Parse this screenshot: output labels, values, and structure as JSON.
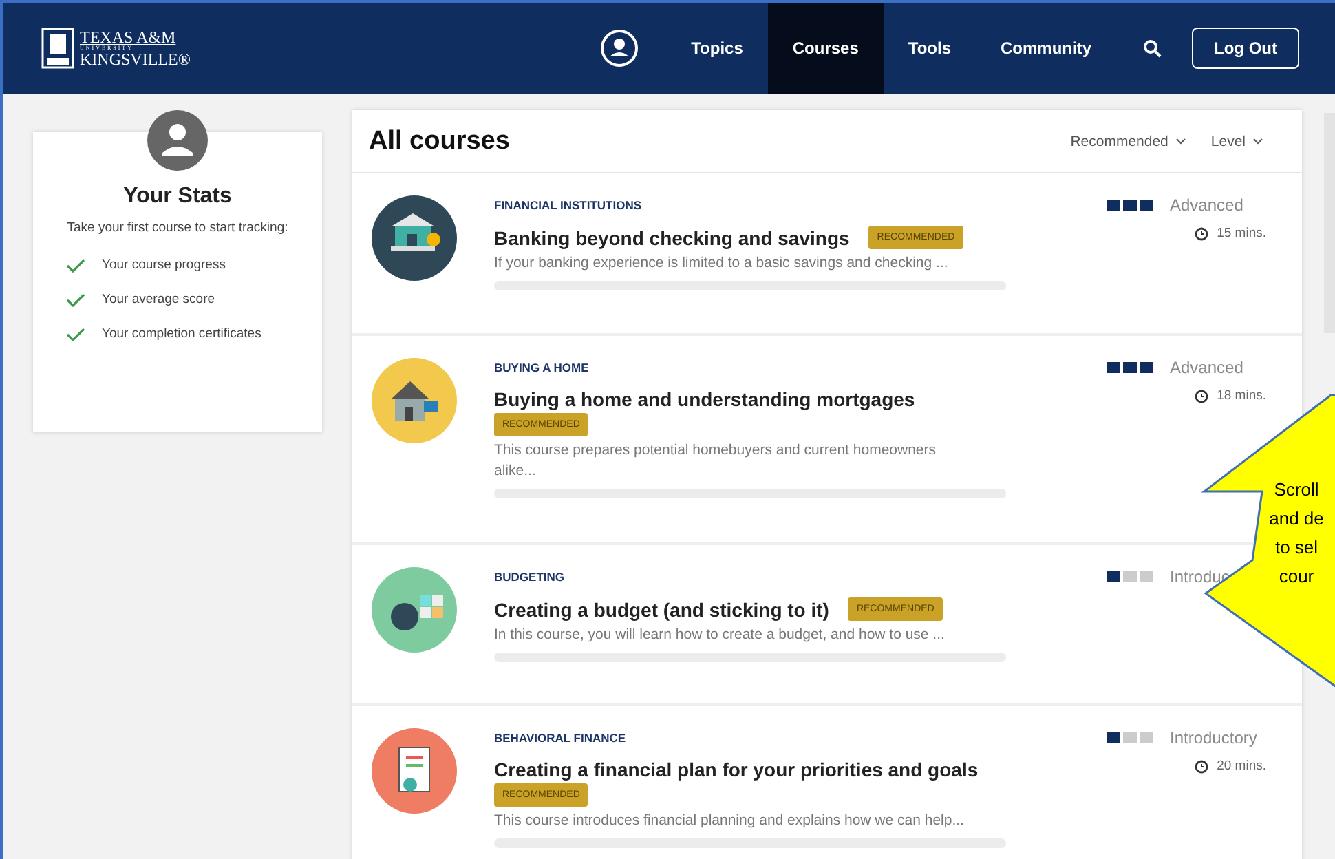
{
  "header": {
    "logo": {
      "line_1": "TEXAS A&M",
      "line_2": "UNIVERSITY",
      "line_3": "KINGSVILLE®"
    },
    "nav": [
      {
        "label": "Topics",
        "selected": false
      },
      {
        "label": "Courses",
        "selected": true
      },
      {
        "label": "Tools",
        "selected": false
      },
      {
        "label": "Community",
        "selected": false
      }
    ],
    "logout": "Log Out"
  },
  "stats": {
    "title": "Your Stats",
    "subtitle": "Take your first course to start tracking:",
    "items": [
      "Your course progress",
      "Your average score",
      "Your completion certificates"
    ]
  },
  "courses": {
    "title": "All courses",
    "filters": [
      "Recommended",
      "Level"
    ],
    "items": [
      {
        "category": "FINANCIAL INSTITUTIONS",
        "title": "Banking beyond checking and savings",
        "badge": "RECOMMENDED",
        "description": "If your banking experience is limited to a basic savings and checking ...",
        "level_name": "Advanced",
        "stars": 3,
        "time": "15 mins.",
        "color": "#2f4858",
        "progress": {
          "level": 0
        }
      },
      {
        "category": "BUYING A HOME",
        "title": "Buying a home and understanding mortgages",
        "badge": "RECOMMENDED",
        "description": "This course prepares potential homebuyers and current homeowners alike...",
        "level_name": "Advanced",
        "stars": 3,
        "time": "18 mins.",
        "color": "#f2c94c",
        "progress": {
          "level": 0
        }
      },
      {
        "category": "BUDGETING",
        "title": "Creating a budget (and sticking to it)",
        "badge": "RECOMMENDED",
        "description": "In this course, you will learn how to create a budget, and how to use ...",
        "level_name": "Introduc",
        "stars": 1,
        "color": "#7fcba0",
        "progress": {
          "level": 0
        }
      },
      {
        "category": "BEHAVIORAL FINANCE",
        "title": "Creating a financial plan for your priorities and goals",
        "badge": "RECOMMENDED",
        "description": "This course introduces financial planning and explains how we can help...",
        "level_name": "Introductory",
        "stars": 1,
        "time": "20 mins.",
        "color": "#ee7d63",
        "progress": {
          "level": 0
        }
      }
    ]
  },
  "callout": {
    "lines": [
      "Scroll",
      "and de",
      "to sel",
      "cour"
    ]
  }
}
